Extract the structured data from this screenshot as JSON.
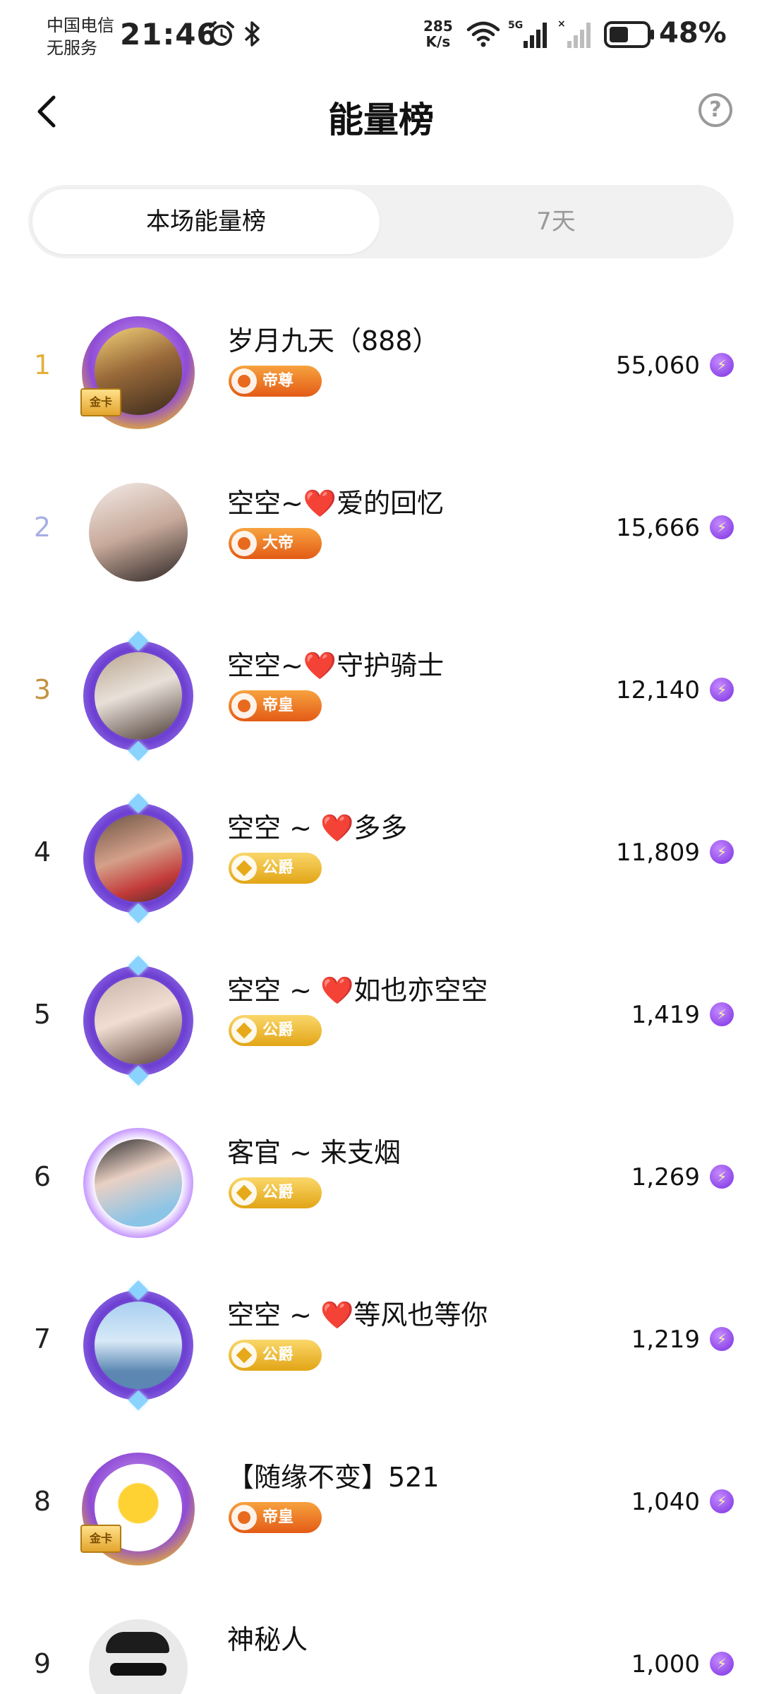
{
  "status_bar": {
    "carrier_line1": "中国电信",
    "carrier_line2": "无服务",
    "time": "21:46",
    "net_speed_value": "285",
    "net_speed_unit": "K/s",
    "battery": "48%",
    "icons": [
      "alarm-icon",
      "bluetooth-icon",
      "wifi-icon",
      "signal-5g-icon",
      "signal-no-sim-icon",
      "battery-icon"
    ]
  },
  "header": {
    "title": "能量榜",
    "back_icon": "chevron-left-icon",
    "help_icon": "question-circle-icon"
  },
  "tabs": [
    {
      "label": "本场能量榜",
      "active": true
    },
    {
      "label": "7天",
      "active": false
    }
  ],
  "ranking": [
    {
      "rank": "1",
      "name": "岁月九天（888）",
      "badge": "帝尊",
      "badge_color": "#e8641c",
      "score": "55,060",
      "frame": "gold-card"
    },
    {
      "rank": "2",
      "name": "空空~❤️爱的回忆",
      "badge": "大帝",
      "badge_color": "#e8641c",
      "score": "15,666",
      "frame": "none"
    },
    {
      "rank": "3",
      "name": "空空~❤️守护骑士",
      "badge": "帝皇",
      "badge_color": "#e8641c",
      "score": "12,140",
      "frame": "purple"
    },
    {
      "rank": "4",
      "name": "空空 ~ ❤️多多",
      "badge": "公爵",
      "badge_color": "#e4a81a",
      "score": "11,809",
      "frame": "purple"
    },
    {
      "rank": "5",
      "name": "空空 ~ ❤️如也亦空空",
      "badge": "公爵",
      "badge_color": "#e4a81a",
      "score": "1,419",
      "frame": "purple"
    },
    {
      "rank": "6",
      "name": "客官 ~ 来支烟",
      "badge": "公爵",
      "badge_color": "#e4a81a",
      "score": "1,269",
      "frame": "lavender"
    },
    {
      "rank": "7",
      "name": "空空 ~ ❤️等风也等你",
      "badge": "公爵",
      "badge_color": "#e4a81a",
      "score": "1,219",
      "frame": "purple"
    },
    {
      "rank": "8",
      "name": "【随缘不变】521",
      "badge": "帝皇",
      "badge_color": "#e8641c",
      "score": "1,040",
      "frame": "gold-card"
    },
    {
      "rank": "9",
      "name": "神秘人",
      "badge": "",
      "badge_color": "",
      "score": "1,000",
      "frame": "none"
    }
  ],
  "card_tag_text": "金卡",
  "score_icon": "energy-bolt-icon",
  "colors": {
    "rank1": "#e3b13a",
    "rank2": "#a8aee6",
    "rank3": "#c4923f",
    "score_icon": "#7a2fe0"
  }
}
